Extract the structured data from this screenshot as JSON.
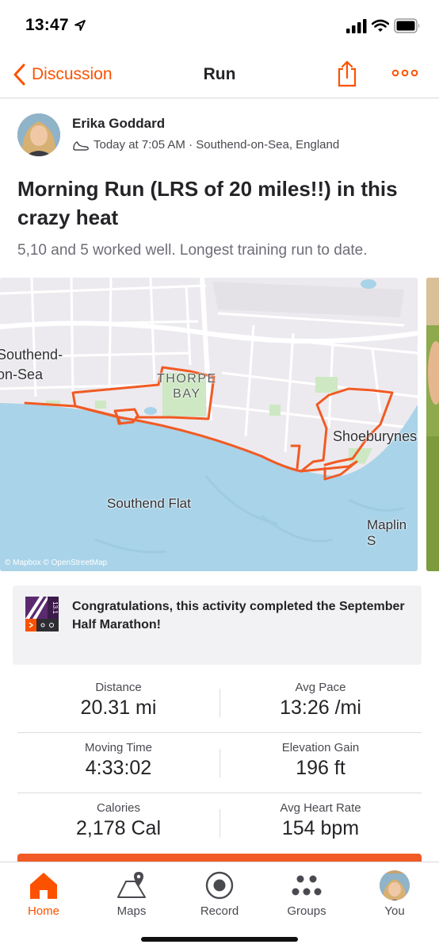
{
  "status_bar": {
    "time": "13:47",
    "icons": [
      "location-arrow-icon",
      "cellular-signal-icon",
      "wifi-icon",
      "battery-icon"
    ]
  },
  "nav": {
    "back_label": "Discussion",
    "title": "Run",
    "icons": [
      "chevron-left-icon",
      "share-icon",
      "more-icon"
    ]
  },
  "activity": {
    "athlete_name": "Erika Goddard",
    "meta": "Today at 7:05 AM · Southend-on-Sea, England",
    "title": "Morning Run (LRS of 20 miles!!) in this crazy heat",
    "description": "5,10 and 5 worked well. Longest training run to date."
  },
  "map": {
    "labels": {
      "town": "Southend-\non-Sea",
      "area": "THORPE\nBAY",
      "shoeburyness": "Shoeburyness",
      "flat": "Southend Flat",
      "maplin": "Maplin S"
    },
    "attribution": "© Mapbox © OpenStreetMap",
    "colors": {
      "land": "#eceaee",
      "water": "#a9d3e8",
      "park": "#cde8c2",
      "route": "#f15a24"
    }
  },
  "challenge": {
    "text": "Congratulations, this activity completed the September Half Marathon!",
    "badge_text": "13.1",
    "badge_icon": "half-marathon-badge-icon",
    "colors": {
      "badge_purple": "#5b2a6e",
      "badge_orange": "#fc5200"
    }
  },
  "stats": [
    {
      "label": "Distance",
      "value": "20.31 mi"
    },
    {
      "label": "Avg Pace",
      "value": "13:26 /mi"
    },
    {
      "label": "Moving Time",
      "value": "4:33:02"
    },
    {
      "label": "Elevation Gain",
      "value": "196 ft"
    },
    {
      "label": "Calories",
      "value": "2,178 Cal"
    },
    {
      "label": "Avg Heart Rate",
      "value": "154 bpm"
    }
  ],
  "tabs": [
    {
      "label": "Home",
      "icon": "home-icon",
      "active": true
    },
    {
      "label": "Maps",
      "icon": "map-icon",
      "active": false
    },
    {
      "label": "Record",
      "icon": "record-icon",
      "active": false
    },
    {
      "label": "Groups",
      "icon": "groups-icon",
      "active": false
    },
    {
      "label": "You",
      "icon": "profile-avatar",
      "active": false
    }
  ],
  "theme": {
    "accent": "#fc5200"
  }
}
